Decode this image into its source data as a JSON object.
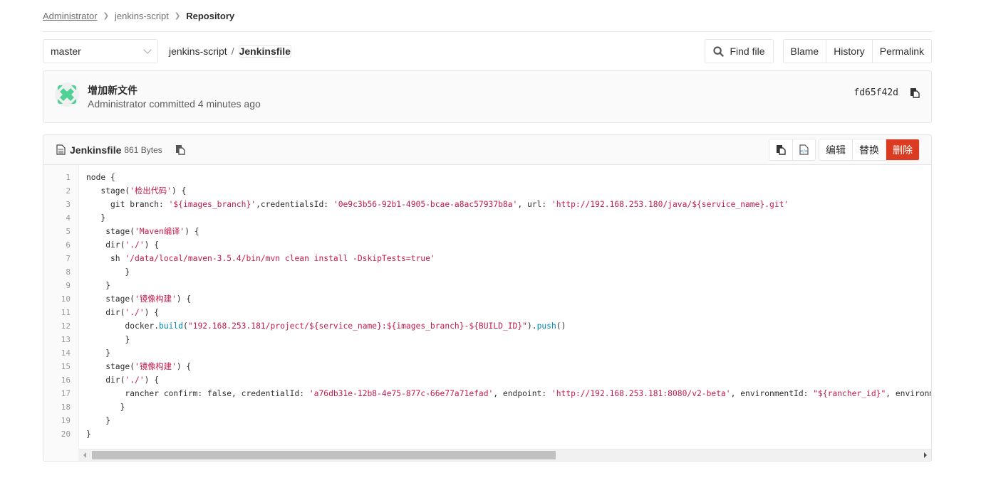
{
  "breadcrumb": {
    "items": [
      {
        "label": "Administrator"
      },
      {
        "label": "jenkins-script"
      },
      {
        "label": "Repository"
      }
    ]
  },
  "nav": {
    "branch": "master",
    "repo": "jenkins-script",
    "separator": "/",
    "file": "Jenkinsfile",
    "find_file": "Find file",
    "blame": "Blame",
    "history": "History",
    "permalink": "Permalink"
  },
  "commit": {
    "title": "增加新文件",
    "meta": "Administrator committed 4 minutes ago",
    "sha": "fd65f42d",
    "avatar_color": "#4fd196"
  },
  "file": {
    "name": "Jenkinsfile",
    "size": "861 Bytes",
    "edit": "编辑",
    "replace": "替换",
    "delete": "删除",
    "delete_color": "#db3b21",
    "lines": [
      {
        "n": "1",
        "parts": [
          [
            "k",
            "node {"
          ]
        ]
      },
      {
        "n": "2",
        "parts": [
          [
            "k",
            "   stage("
          ],
          [
            "s",
            "'检出代码'"
          ],
          [
            "k",
            ") {"
          ]
        ]
      },
      {
        "n": "3",
        "parts": [
          [
            "k",
            "     git branch: "
          ],
          [
            "s",
            "'${images_branch}'"
          ],
          [
            "k",
            ",credentialsId: "
          ],
          [
            "s",
            "'0e9c3b56-92b1-4905-bcae-a8ac57937b8a'"
          ],
          [
            "k",
            ", url: "
          ],
          [
            "s",
            "'http://192.168.253.180/java/${service_name}.git'"
          ]
        ]
      },
      {
        "n": "4",
        "parts": [
          [
            "k",
            "   }"
          ]
        ]
      },
      {
        "n": "5",
        "parts": [
          [
            "k",
            "    stage("
          ],
          [
            "s",
            "'Maven编译'"
          ],
          [
            "k",
            ") {"
          ]
        ]
      },
      {
        "n": "6",
        "parts": [
          [
            "k",
            "    dir("
          ],
          [
            "s",
            "'./'"
          ],
          [
            "k",
            ") {"
          ]
        ]
      },
      {
        "n": "7",
        "parts": [
          [
            "k",
            "     sh "
          ],
          [
            "s",
            "'/data/local/maven-3.5.4/bin/mvn clean install -DskipTests=true'"
          ]
        ]
      },
      {
        "n": "8",
        "parts": [
          [
            "k",
            "        }"
          ]
        ]
      },
      {
        "n": "9",
        "parts": [
          [
            "k",
            "    }"
          ]
        ]
      },
      {
        "n": "10",
        "parts": [
          [
            "k",
            "    stage("
          ],
          [
            "s",
            "'镜像构建'"
          ],
          [
            "k",
            ") {"
          ]
        ]
      },
      {
        "n": "11",
        "parts": [
          [
            "k",
            "    dir("
          ],
          [
            "s",
            "'./'"
          ],
          [
            "k",
            ") {"
          ]
        ]
      },
      {
        "n": "12",
        "parts": [
          [
            "k",
            "        docker."
          ],
          [
            "m",
            "build"
          ],
          [
            "k",
            "("
          ],
          [
            "s",
            "\"192.168.253.181/project/${service_name}:${images_branch}-${BUILD_ID}\""
          ],
          [
            "k",
            ")."
          ],
          [
            "m",
            "push"
          ],
          [
            "k",
            "()"
          ]
        ]
      },
      {
        "n": "13",
        "parts": [
          [
            "k",
            "        }"
          ]
        ]
      },
      {
        "n": "14",
        "parts": [
          [
            "k",
            "    }"
          ]
        ]
      },
      {
        "n": "15",
        "parts": [
          [
            "k",
            "    stage("
          ],
          [
            "s",
            "'镜像构建'"
          ],
          [
            "k",
            ") {"
          ]
        ]
      },
      {
        "n": "16",
        "parts": [
          [
            "k",
            "    dir("
          ],
          [
            "s",
            "'./'"
          ],
          [
            "k",
            ") {"
          ]
        ]
      },
      {
        "n": "17",
        "parts": [
          [
            "k",
            "        rancher confirm: false, credentialId: "
          ],
          [
            "s",
            "'a76db31e-12b8-4e75-877c-66e77a71efad'"
          ],
          [
            "k",
            ", endpoint: "
          ],
          [
            "s",
            "'http://192.168.253.181:8080/v2-beta'"
          ],
          [
            "k",
            ", environmentId: "
          ],
          [
            "s",
            "\"${rancher_id}\""
          ],
          [
            "k",
            ", environments: "
          ]
        ]
      },
      {
        "n": "18",
        "parts": [
          [
            "k",
            "       }"
          ]
        ]
      },
      {
        "n": "19",
        "parts": [
          [
            "k",
            "    }"
          ]
        ]
      },
      {
        "n": "20",
        "parts": [
          [
            "k",
            "}"
          ]
        ]
      }
    ],
    "scroll_position": 0.0,
    "scroll_visible_fraction": 0.56
  }
}
